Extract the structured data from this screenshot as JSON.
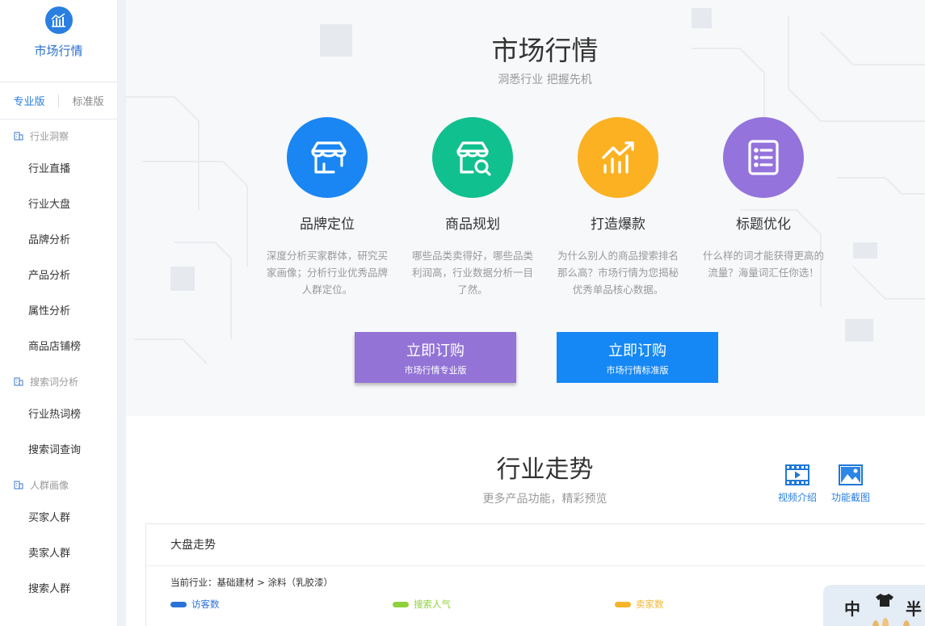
{
  "sidebar": {
    "title": "市场行情",
    "editions": [
      "专业版",
      "标准版"
    ],
    "groups": [
      {
        "title": "行业洞察",
        "items": [
          "行业直播",
          "行业大盘",
          "品牌分析",
          "产品分析",
          "属性分析",
          "商品店铺榜"
        ]
      },
      {
        "title": "搜索词分析",
        "items": [
          "行业热词榜",
          "搜索词查询"
        ]
      },
      {
        "title": "人群画像",
        "items": [
          "买家人群",
          "卖家人群",
          "搜索人群"
        ]
      }
    ]
  },
  "hero": {
    "title": "市场行情",
    "subtitle": "洞悉行业 把握先机",
    "features": [
      {
        "title": "品牌定位",
        "desc": "深度分析买家群体，研究买家画像；分析行业优秀品牌人群定位。",
        "color": "#1a86f3",
        "icon": "store-icon"
      },
      {
        "title": "商品规划",
        "desc": "哪些品类卖得好，哪些品类利润高，行业数据分析一目了然。",
        "color": "#11c08f",
        "icon": "shop-search-icon"
      },
      {
        "title": "打造爆款",
        "desc": "为什么别人的商品搜索排名那么高？市场行情为您揭秘优秀单品核心数据。",
        "color": "#fbb121",
        "icon": "trend-chart-icon"
      },
      {
        "title": "标题优化",
        "desc": "什么样的词才能获得更高的流量？海量词汇任你选！",
        "color": "#9473dc",
        "icon": "list-icon"
      }
    ],
    "buy_pro": {
      "label": "立即订购",
      "sub": "市场行情专业版",
      "color": "#9374d6"
    },
    "buy_std": {
      "label": "立即订购",
      "sub": "市场行情标准版",
      "color": "#1588f5"
    }
  },
  "trend": {
    "title": "行业走势",
    "subtitle": "更多产品功能，精彩预览",
    "video_label": "视频介绍",
    "screenshot_label": "功能截图"
  },
  "panel": {
    "title": "大盘走势",
    "industry": "当前行业：基础建材 > 涂料（乳胶漆）",
    "legend": [
      {
        "label": "访客数",
        "color": "#2a72d8"
      },
      {
        "label": "搜索人气",
        "color": "#8fd13a"
      },
      {
        "label": "卖家数",
        "color": "#f5b52a"
      }
    ]
  },
  "widget": {
    "char1": "中",
    "char2": "半"
  }
}
